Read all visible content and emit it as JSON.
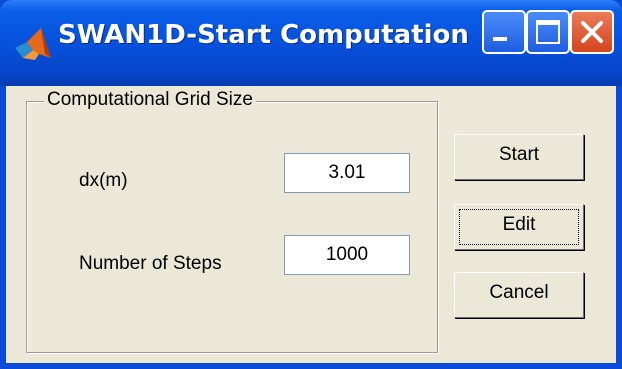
{
  "window": {
    "title": "SWAN1D-Start Computation"
  },
  "titlebar_buttons": {
    "minimize": "minimize",
    "maximize": "maximize",
    "close": "close"
  },
  "group": {
    "title": "Computational Grid Size",
    "dx_label": "dx(m)",
    "dx_value": "3.01",
    "steps_label": "Number of Steps",
    "steps_value": "1000"
  },
  "buttons": {
    "start": "Start",
    "edit": "Edit",
    "cancel": "Cancel"
  },
  "icons": {
    "app": "matlab-logo-icon",
    "minimize": "minimize-icon",
    "maximize": "maximize-icon",
    "close": "close-icon"
  },
  "colors": {
    "titlebar": "#0751dc",
    "client": "#ebe8d8",
    "close_button": "#d3451f",
    "field_border": "#7f9db9"
  }
}
